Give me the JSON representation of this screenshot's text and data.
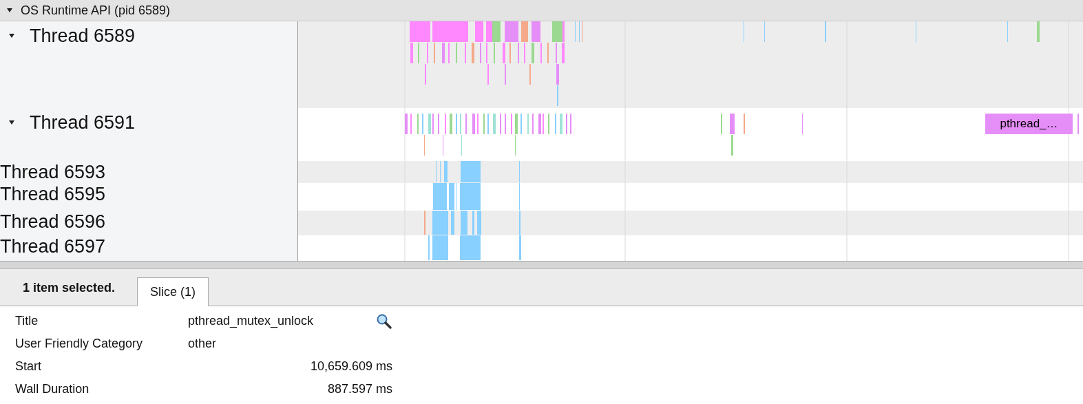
{
  "process": {
    "title": "OS Runtime API (pid 6589)",
    "expanded": true
  },
  "threads": [
    {
      "name": "Thread 6589",
      "kind": "expandable",
      "expanded": true
    },
    {
      "name": "Thread 6591",
      "kind": "expandable",
      "expanded": true,
      "slice_label": "pthread_…"
    },
    {
      "name": "Thread 6593",
      "kind": "plain"
    },
    {
      "name": "Thread 6595",
      "kind": "plain"
    },
    {
      "name": "Thread 6596",
      "kind": "plain"
    },
    {
      "name": "Thread 6597",
      "kind": "plain"
    }
  ],
  "selection": {
    "summary": "1 item selected.",
    "tabs": [
      {
        "label": "Slice (1)",
        "selected": true
      }
    ]
  },
  "details": [
    {
      "label": "Title",
      "value": "pthread_mutex_unlock",
      "kind": "text",
      "search": true
    },
    {
      "label": "User Friendly Category",
      "value": "other",
      "kind": "text",
      "search": false
    },
    {
      "label": "Start",
      "value": "10,659.609 ms",
      "kind": "number",
      "search": false
    },
    {
      "label": "Wall Duration",
      "value": "887.597 ms",
      "kind": "number",
      "search": false
    }
  ]
}
